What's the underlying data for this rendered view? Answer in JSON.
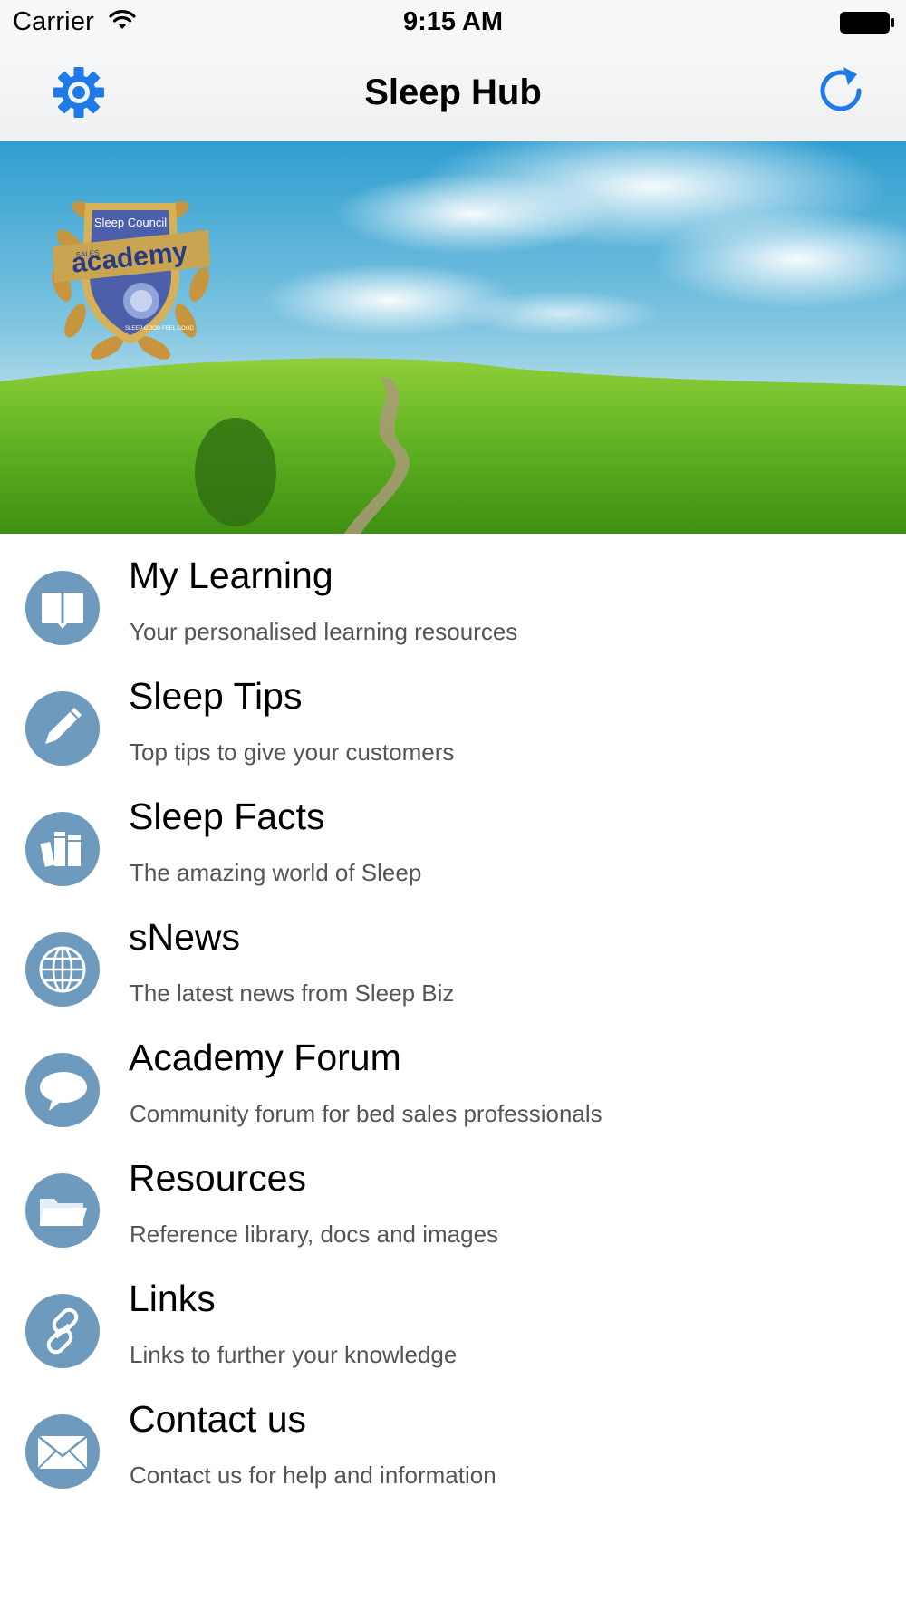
{
  "status_bar": {
    "carrier": "Carrier",
    "time": "9:15 AM"
  },
  "nav": {
    "title": "Sleep Hub",
    "settings_icon": "gear-icon",
    "refresh_icon": "refresh-icon",
    "tint_color": "#1e7ae6"
  },
  "hero": {
    "badge": {
      "top_text": "Sleep Council",
      "ribbon_small": "SALES",
      "ribbon_text": "academy",
      "ring_text": "SLEEP GOOD FEEL GOOD"
    }
  },
  "menu": {
    "icon_color": "#6e9bbd",
    "items": [
      {
        "title": "My Learning",
        "subtitle": "Your personalised learning resources",
        "icon": "book-icon"
      },
      {
        "title": "Sleep Tips",
        "subtitle": "Top tips to give your customers",
        "icon": "pen-icon"
      },
      {
        "title": "Sleep Facts",
        "subtitle": "The amazing world of Sleep",
        "icon": "books-icon"
      },
      {
        "title": "sNews",
        "subtitle": "The latest news from Sleep Biz",
        "icon": "globe-icon"
      },
      {
        "title": "Academy Forum",
        "subtitle": "Community forum for bed sales professionals",
        "icon": "speech-bubble-icon"
      },
      {
        "title": "Resources",
        "subtitle": "Reference library, docs and images",
        "icon": "folder-icon"
      },
      {
        "title": "Links",
        "subtitle": "Links to further your knowledge",
        "icon": "link-icon"
      },
      {
        "title": "Contact us",
        "subtitle": "Contact us for help and information",
        "icon": "envelope-icon"
      }
    ]
  }
}
